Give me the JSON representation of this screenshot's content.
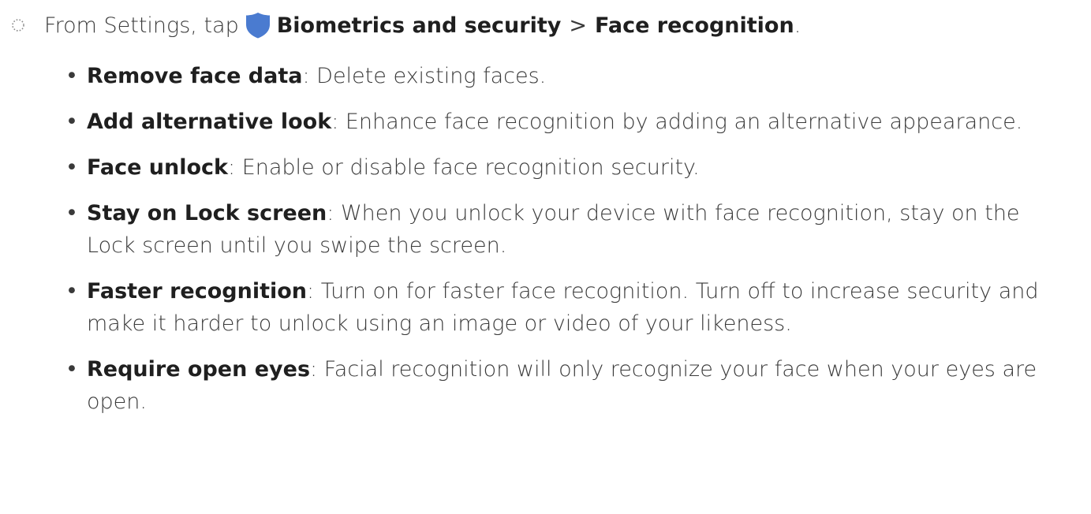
{
  "step": {
    "marker_icon": "dotted-circle-icon",
    "prefix": "From Settings, tap",
    "shield_icon": "shield-icon",
    "shield_color": "#4a7bd0",
    "menu1": "Biometrics and security",
    "separator": ">",
    "menu2": "Face recognition",
    "suffix": "."
  },
  "options": [
    {
      "term": "Remove face data",
      "desc": ": Delete existing faces."
    },
    {
      "term": "Add alternative look",
      "desc": ": Enhance face recognition by adding an alternative appearance."
    },
    {
      "term": "Face unlock",
      "desc": ": Enable or disable face recognition security."
    },
    {
      "term": "Stay on Lock screen",
      "desc": ": When you unlock your device with face recognition, stay on the Lock screen until you swipe the screen."
    },
    {
      "term": "Faster recognition",
      "desc": ": Turn on for faster face recognition. Turn off to increase security and make it harder to unlock using an image or video of your likeness."
    },
    {
      "term": "Require open eyes",
      "desc": ": Facial recognition will only recognize your face when your eyes are open."
    }
  ],
  "bullet_char": "•"
}
